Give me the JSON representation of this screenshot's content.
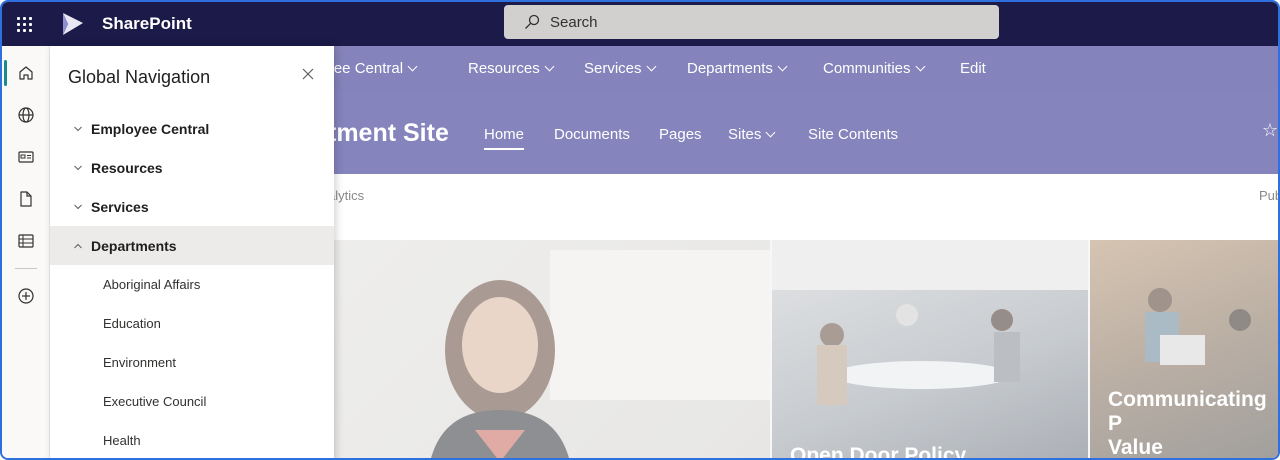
{
  "suite_bar": {
    "app_name": "SharePoint",
    "search_placeholder": "Search"
  },
  "app_rail": {
    "items": [
      {
        "icon": "home-icon",
        "active": true
      },
      {
        "icon": "globe-icon"
      },
      {
        "icon": "news-icon"
      },
      {
        "icon": "document-icon"
      },
      {
        "icon": "lists-icon"
      },
      {
        "icon": "create-icon"
      }
    ]
  },
  "hub_nav": {
    "items": [
      {
        "label": "oyee Central",
        "has_dropdown": true
      },
      {
        "label": "Resources",
        "has_dropdown": true
      },
      {
        "label": "Services",
        "has_dropdown": true
      },
      {
        "label": "Departments",
        "has_dropdown": true
      },
      {
        "label": "Communities",
        "has_dropdown": true
      },
      {
        "label": "Edit",
        "has_dropdown": false
      }
    ]
  },
  "site_header": {
    "title": "tment Site",
    "tabs": [
      {
        "label": "Home",
        "selected": true
      },
      {
        "label": "Documents"
      },
      {
        "label": "Pages"
      },
      {
        "label": "Sites",
        "has_dropdown": true
      },
      {
        "label": "Site Contents"
      }
    ],
    "star_icon": "☆"
  },
  "command_bar": {
    "left_text": "alytics",
    "right_text": "Pub"
  },
  "hero": {
    "tiles": [
      {
        "caption": ""
      },
      {
        "caption": "Open Door Policy"
      },
      {
        "caption_lines": [
          "Communicating P",
          "Value"
        ]
      }
    ]
  },
  "nav_panel": {
    "title": "Global Navigation",
    "close_icon": "✕",
    "sections": [
      {
        "label": "Employee Central",
        "expanded": false
      },
      {
        "label": "Resources",
        "expanded": false
      },
      {
        "label": "Services",
        "expanded": false
      },
      {
        "label": "Departments",
        "expanded": true
      }
    ],
    "department_links": [
      "Aboriginal Affairs",
      "Education",
      "Environment",
      "Executive Council",
      "Health"
    ]
  },
  "colors": {
    "suite_bar": "#1b1a48",
    "hub_nav": "#2b2a8a",
    "site_header": "#2d2c8d",
    "frame_border": "#2f6fde",
    "rail_active": "#1b8a8f"
  }
}
